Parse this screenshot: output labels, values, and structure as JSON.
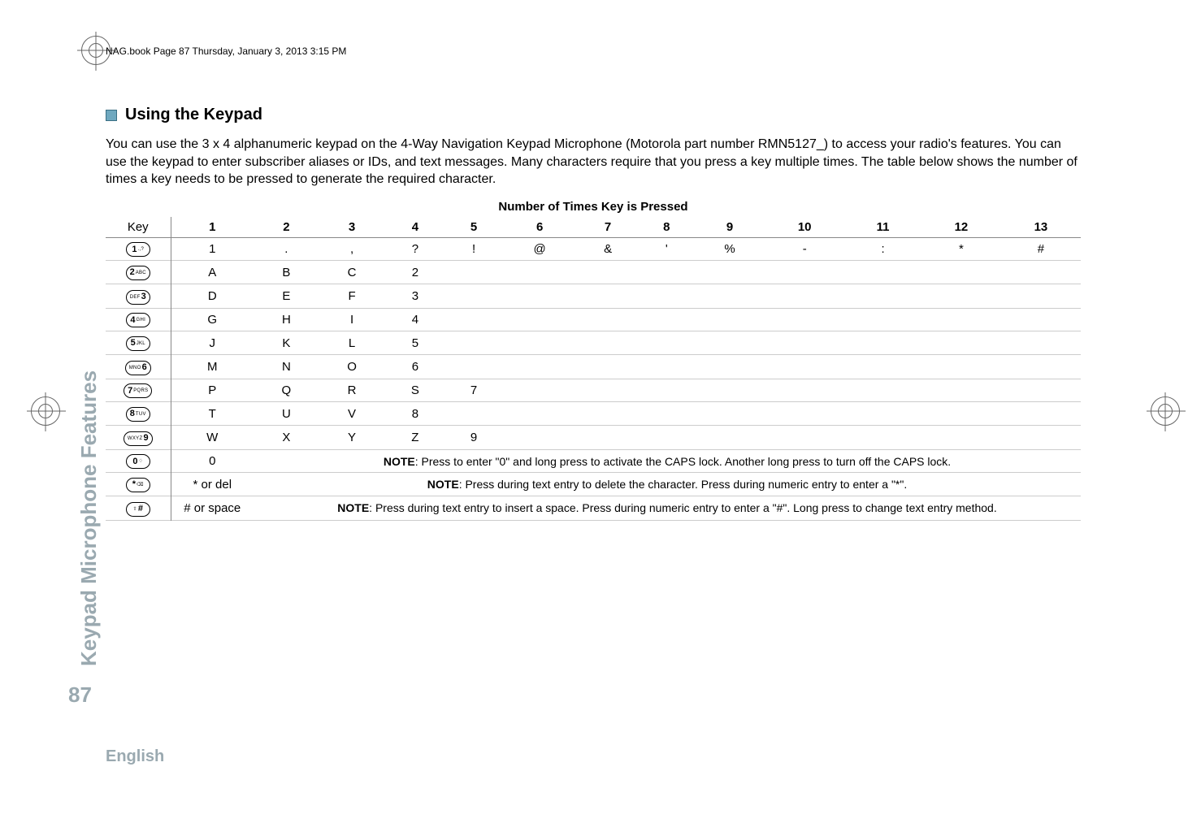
{
  "header_text": "NAG.book  Page 87  Thursday, January 3, 2013  3:15 PM",
  "section_title": "Using the Keypad",
  "intro": "You can use the 3 x 4 alphanumeric keypad on the 4-Way Navigation Keypad Microphone (Motorola part number RMN5127_) to access your radio's features. You can use the keypad to enter subscriber aliases or IDs, and text messages. Many characters require that you press a key multiple times. The table below shows the number of times a key needs to be pressed to generate the required character.",
  "table_caption": "Number of Times Key is Pressed",
  "side_label": "Keypad Microphone Features",
  "page_num": "87",
  "footer_lang": "English",
  "cols": {
    "key": "Key",
    "c1": "1",
    "c2": "2",
    "c3": "3",
    "c4": "4",
    "c5": "5",
    "c6": "6",
    "c7": "7",
    "c8": "8",
    "c9": "9",
    "c10": "10",
    "c11": "11",
    "c12": "12",
    "c13": "13"
  },
  "keys": {
    "k1": {
      "big": "1",
      "small": ".,?"
    },
    "k2": {
      "big": "2",
      "small": "ABC"
    },
    "k3": {
      "big": "3",
      "small": "DEF"
    },
    "k4": {
      "big": "4",
      "small": "GHI"
    },
    "k5": {
      "big": "5",
      "small": "JKL"
    },
    "k6": {
      "big": "6",
      "small": "MNO"
    },
    "k7": {
      "big": "7",
      "small": "PQRS"
    },
    "k8": {
      "big": "8",
      "small": "TUV"
    },
    "k9": {
      "big": "9",
      "small": "WXYZ"
    },
    "k0": {
      "big": "0",
      "small": "♢"
    },
    "kstar": {
      "big": "*",
      "small": "⌫"
    },
    "khash": {
      "big": "#",
      "small": "⇧"
    }
  },
  "rows": {
    "r1": [
      "1",
      ".",
      ",",
      "?",
      "!",
      "@",
      "&",
      "'",
      "%",
      "-",
      ":",
      "*",
      "#"
    ],
    "r2": [
      "A",
      "B",
      "C",
      "2"
    ],
    "r3": [
      "D",
      "E",
      "F",
      "3"
    ],
    "r4": [
      "G",
      "H",
      "I",
      "4"
    ],
    "r5": [
      "J",
      "K",
      "L",
      "5"
    ],
    "r6": [
      "M",
      "N",
      "O",
      "6"
    ],
    "r7": [
      "P",
      "Q",
      "R",
      "S",
      "7"
    ],
    "r8": [
      "T",
      "U",
      "V",
      "8"
    ],
    "r9": [
      "W",
      "X",
      "Y",
      "Z",
      "9"
    ],
    "r0": [
      "0"
    ],
    "rstar": [
      "* or del"
    ],
    "rhash": [
      "# or space"
    ]
  },
  "notes": {
    "n0_label": "NOTE",
    "n0_text": ": Press to enter \"0\" and long press to activate the CAPS lock. Another long press to turn off the CAPS lock.",
    "nstar_label": "NOTE",
    "nstar_text": ": Press during text entry to delete the character. Press during numeric entry to enter a \"*\".",
    "nhash_label": "NOTE",
    "nhash_text": ": Press during text entry to insert a space. Press during numeric entry to enter a \"#\". Long press to change text entry method."
  }
}
